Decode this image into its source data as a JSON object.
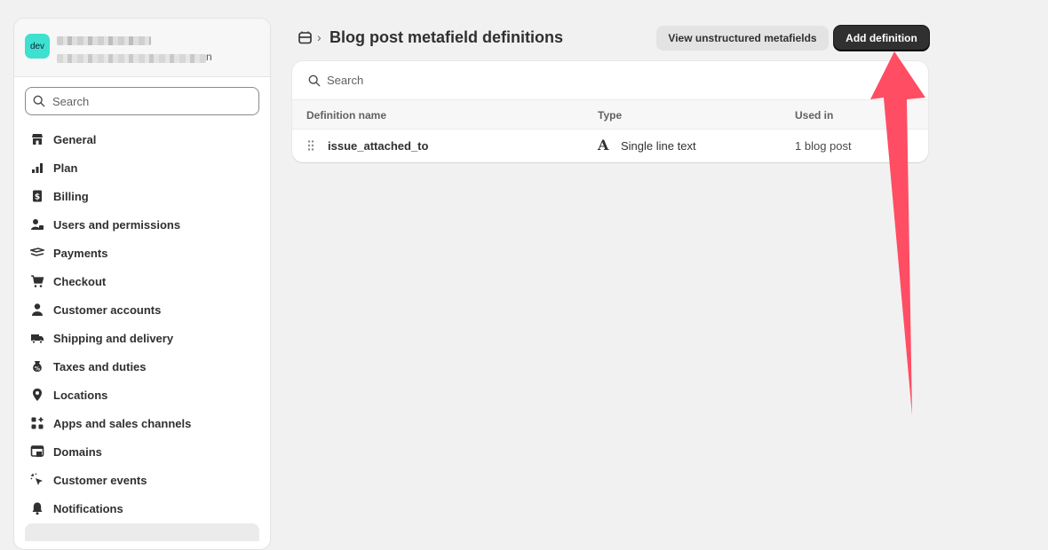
{
  "store": {
    "avatar_text": "dev",
    "url_tail": "n"
  },
  "sidebar": {
    "search_placeholder": "Search",
    "items": [
      {
        "label": "General",
        "icon": "store-icon"
      },
      {
        "label": "Plan",
        "icon": "plan-icon"
      },
      {
        "label": "Billing",
        "icon": "billing-icon"
      },
      {
        "label": "Users and permissions",
        "icon": "users-icon"
      },
      {
        "label": "Payments",
        "icon": "payments-icon"
      },
      {
        "label": "Checkout",
        "icon": "cart-icon"
      },
      {
        "label": "Customer accounts",
        "icon": "person-icon"
      },
      {
        "label": "Shipping and delivery",
        "icon": "truck-icon"
      },
      {
        "label": "Taxes and duties",
        "icon": "tax-icon"
      },
      {
        "label": "Locations",
        "icon": "location-pin-icon"
      },
      {
        "label": "Apps and sales channels",
        "icon": "apps-icon"
      },
      {
        "label": "Domains",
        "icon": "domains-icon"
      },
      {
        "label": "Customer events",
        "icon": "cursor-click-icon"
      },
      {
        "label": "Notifications",
        "icon": "bell-icon"
      }
    ]
  },
  "header": {
    "breadcrumb_icon": "blog-icon",
    "breadcrumb_sep": "›",
    "title": "Blog post metafield definitions",
    "secondary_button": "View unstructured metafields",
    "primary_button": "Add definition"
  },
  "table": {
    "search_placeholder": "Search",
    "columns": [
      "Definition name",
      "Type",
      "Used in"
    ],
    "rows": [
      {
        "name": "issue_attached_to",
        "type_icon": "text-type-icon",
        "type_glyph": "A",
        "type": "Single line text",
        "used_in": "1 blog post"
      }
    ]
  },
  "annotation": {
    "arrow_color": "#ff4d64"
  }
}
